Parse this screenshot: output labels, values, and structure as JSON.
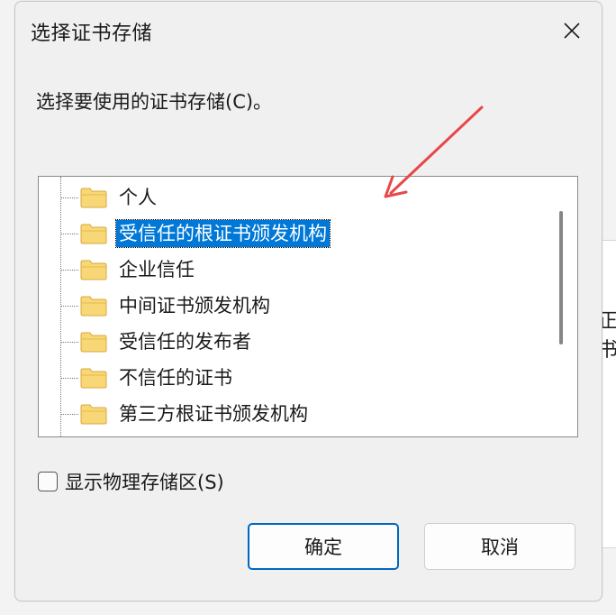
{
  "background": {
    "partial_text": "正书"
  },
  "dialog": {
    "title": "选择证书存储",
    "prompt": "选择要使用的证书存储(C)。",
    "tree": {
      "items": [
        {
          "label": "个人",
          "selected": false
        },
        {
          "label": "受信任的根证书颁发机构",
          "selected": true
        },
        {
          "label": "企业信任",
          "selected": false
        },
        {
          "label": "中间证书颁发机构",
          "selected": false
        },
        {
          "label": "受信任的发布者",
          "selected": false
        },
        {
          "label": "不信任的证书",
          "selected": false
        },
        {
          "label": "第三方根证书颁发机构",
          "selected": false
        }
      ]
    },
    "show_physical_label": "显示物理存储区(S)",
    "show_physical_checked": false,
    "ok_label": "确定",
    "cancel_label": "取消"
  },
  "colors": {
    "selection": "#0078d7",
    "annotation_arrow": "#e8474a",
    "primary_button_border": "#0067c0"
  },
  "icons": {
    "close": "close-icon",
    "folder": "folder-icon"
  }
}
